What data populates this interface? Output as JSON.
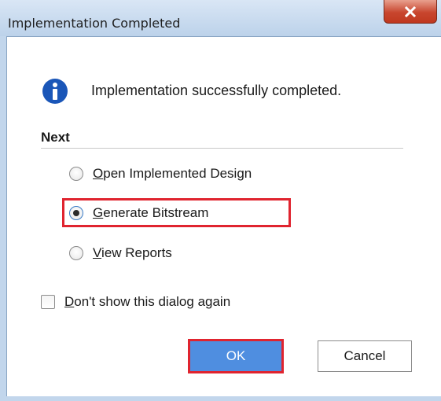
{
  "window": {
    "title": "Implementation Completed",
    "close_glyph": "x"
  },
  "message": {
    "icon": "info-icon",
    "text": "Implementation successfully completed."
  },
  "next": {
    "title": "Next",
    "options": [
      {
        "mnemonic": "O",
        "rest": "pen Implemented Design",
        "checked": false
      },
      {
        "mnemonic": "G",
        "rest": "enerate Bitstream",
        "checked": true,
        "highlighted": true
      },
      {
        "mnemonic": "V",
        "rest": "iew Reports",
        "checked": false
      }
    ]
  },
  "dont_show": {
    "mnemonic": "D",
    "rest": "on't show this dialog again",
    "checked": false
  },
  "buttons": {
    "ok_label": "OK",
    "cancel_label": "Cancel"
  },
  "colors": {
    "highlight": "#e0242f",
    "ok_button": "#4f8ee0",
    "info_icon": "#1a56b8"
  }
}
